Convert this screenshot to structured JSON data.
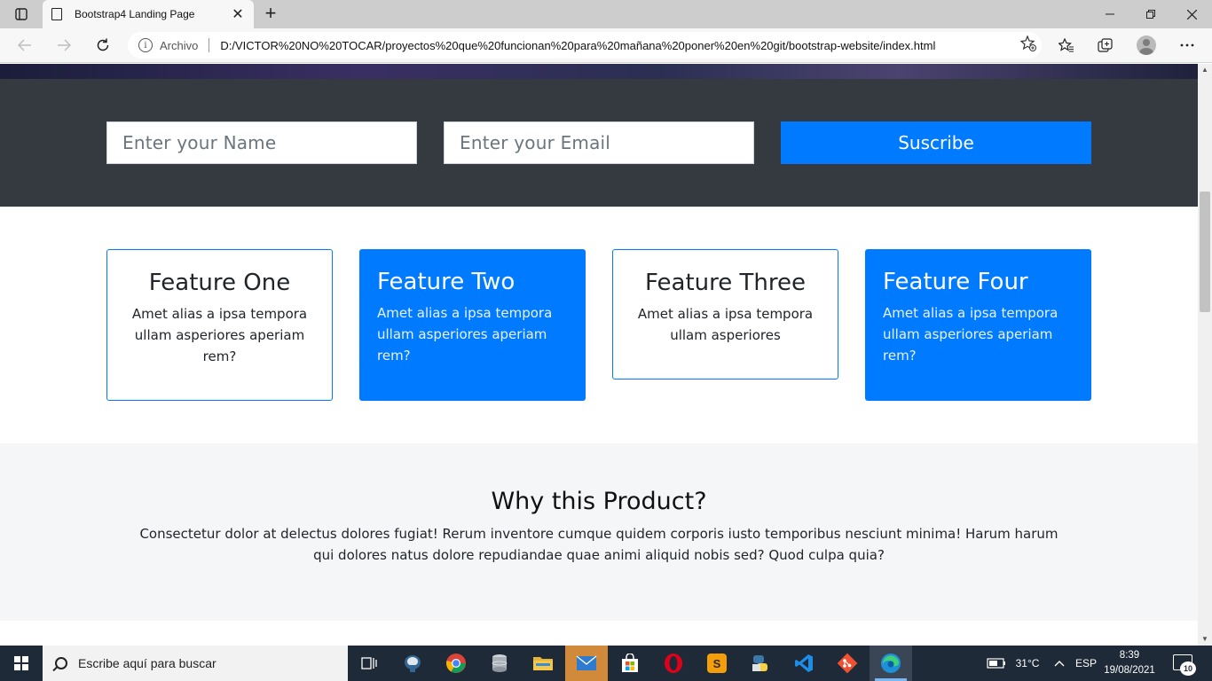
{
  "browser": {
    "tab_title": "Bootstrap4 Landing Page",
    "tab_close": "✕",
    "new_tab": "+",
    "security_label": "Archivo",
    "url": "D:/VICTOR%20NO%20TOCAR/proyectos%20que%20funcionan%20para%20mañana%20poner%20en%20git/bootstrap-website/index.html",
    "window_controls": {
      "minimize": "—",
      "restore": "❐",
      "close": "✕"
    }
  },
  "page": {
    "subscribe": {
      "name_placeholder": "Enter your Name",
      "email_placeholder": "Enter your Email",
      "button_label": "Suscribe"
    },
    "features": [
      {
        "title": "Feature One",
        "text": "Amet alias a ipsa tempora ullam asperiores aperiam rem?",
        "style": "outline"
      },
      {
        "title": "Feature Two",
        "text": "Amet alias a ipsa tempora ullam asperiores aperiam rem?",
        "style": "solid"
      },
      {
        "title": "Feature Three",
        "text": "Amet alias a ipsa tempora ullam asperiores",
        "style": "outline"
      },
      {
        "title": "Feature Four",
        "text": "Amet alias a ipsa tempora ullam asperiores aperiam rem?",
        "style": "solid"
      }
    ],
    "why": {
      "title": "Why this Product?",
      "text": "Consectetur dolor at delectus dolores fugiat! Rerum inventore cumque quidem corporis iusto temporibus nesciunt minima! Harum harum qui dolores natus dolore repudiandae quae animi aliquid nobis sed? Quod culpa quia?"
    },
    "colors": {
      "primary": "#007bff",
      "dark": "#343a40",
      "light": "#f5f6f8"
    }
  },
  "taskbar": {
    "search_placeholder": "Escribe aquí para buscar",
    "apps": [
      "task-view",
      "pgadmin",
      "chrome",
      "database",
      "file-explorer",
      "mail",
      "store",
      "opera",
      "sublime-text",
      "python",
      "vscode",
      "git",
      "edge"
    ],
    "weather": "31°C",
    "language": "ESP",
    "time": "8:39",
    "date": "19/08/2021",
    "notifications": "10"
  }
}
